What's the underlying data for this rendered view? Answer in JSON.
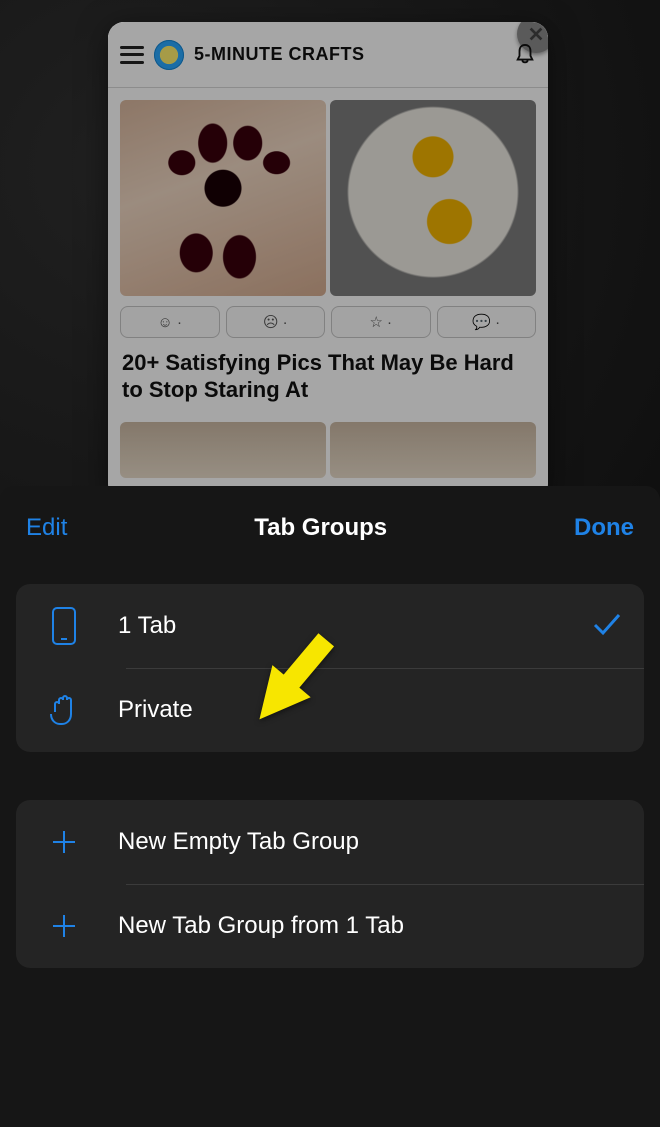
{
  "preview": {
    "site_title": "5-MINUTE CRAFTS",
    "reactions": {
      "smile": "☺ ·",
      "sad": "☹ ·",
      "star": "☆ ·",
      "comment": "💬 ·"
    },
    "headline": "20+ Satisfying Pics That May Be Hard to Stop Staring At"
  },
  "sheet": {
    "edit_label": "Edit",
    "title": "Tab Groups",
    "done_label": "Done",
    "group1": [
      {
        "label": "1 Tab",
        "checked": true
      },
      {
        "label": "Private",
        "checked": false
      }
    ],
    "group2": [
      {
        "label": "New Empty Tab Group"
      },
      {
        "label": "New Tab Group from 1 Tab"
      }
    ]
  }
}
